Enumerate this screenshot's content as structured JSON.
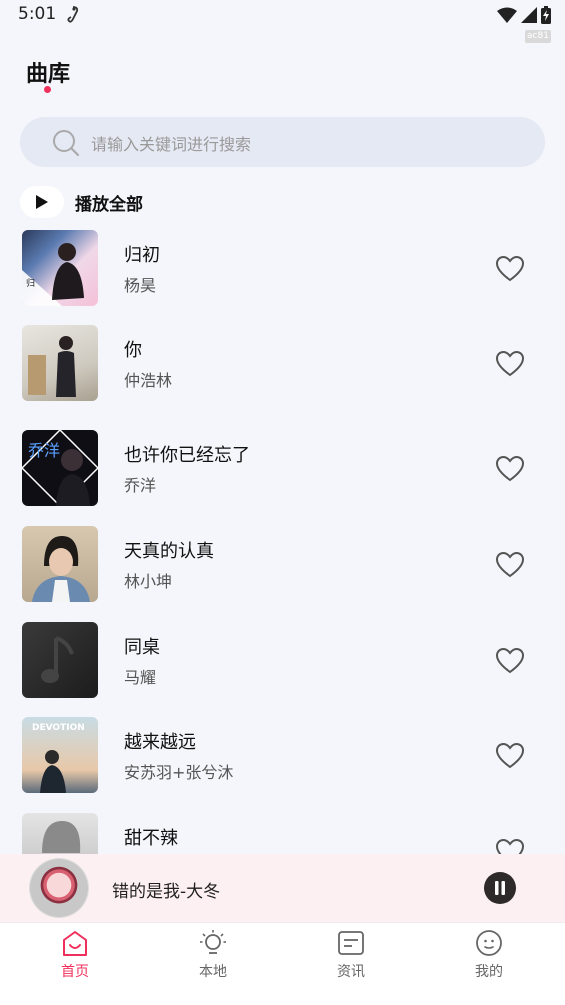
{
  "status_bar": {
    "time": "5:01",
    "debug_tag": "ac81"
  },
  "page": {
    "title": "曲库"
  },
  "search": {
    "placeholder": "请输入关键词进行搜索"
  },
  "play_all": {
    "label": "播放全部"
  },
  "songs": [
    {
      "title": "归初",
      "artist": "杨昊"
    },
    {
      "title": "你",
      "artist": "仲浩林"
    },
    {
      "title": "也许你已经忘了",
      "artist": "乔洋"
    },
    {
      "title": "天真的认真",
      "artist": "林小坤"
    },
    {
      "title": "同桌",
      "artist": "马耀"
    },
    {
      "title": "越来越远",
      "artist": "安苏羽+张兮沐"
    },
    {
      "title": "甜不辣",
      "artist": ""
    }
  ],
  "cover_texts": {
    "song3_text": "乔洋",
    "song6_text": "DEVOTION"
  },
  "mini_player": {
    "now_playing": "错的是我-大冬"
  },
  "nav": [
    {
      "label": "首页",
      "icon": "home-smile-icon",
      "active": true
    },
    {
      "label": "本地",
      "icon": "lightbulb-icon",
      "active": false
    },
    {
      "label": "资讯",
      "icon": "news-icon",
      "active": false
    },
    {
      "label": "我的",
      "icon": "profile-face-icon",
      "active": false
    }
  ],
  "colors": {
    "accent": "#f0305c",
    "background": "#f5f6fb",
    "mini_player_bg": "#fdf0f2",
    "search_bg": "#e5e9f3"
  }
}
